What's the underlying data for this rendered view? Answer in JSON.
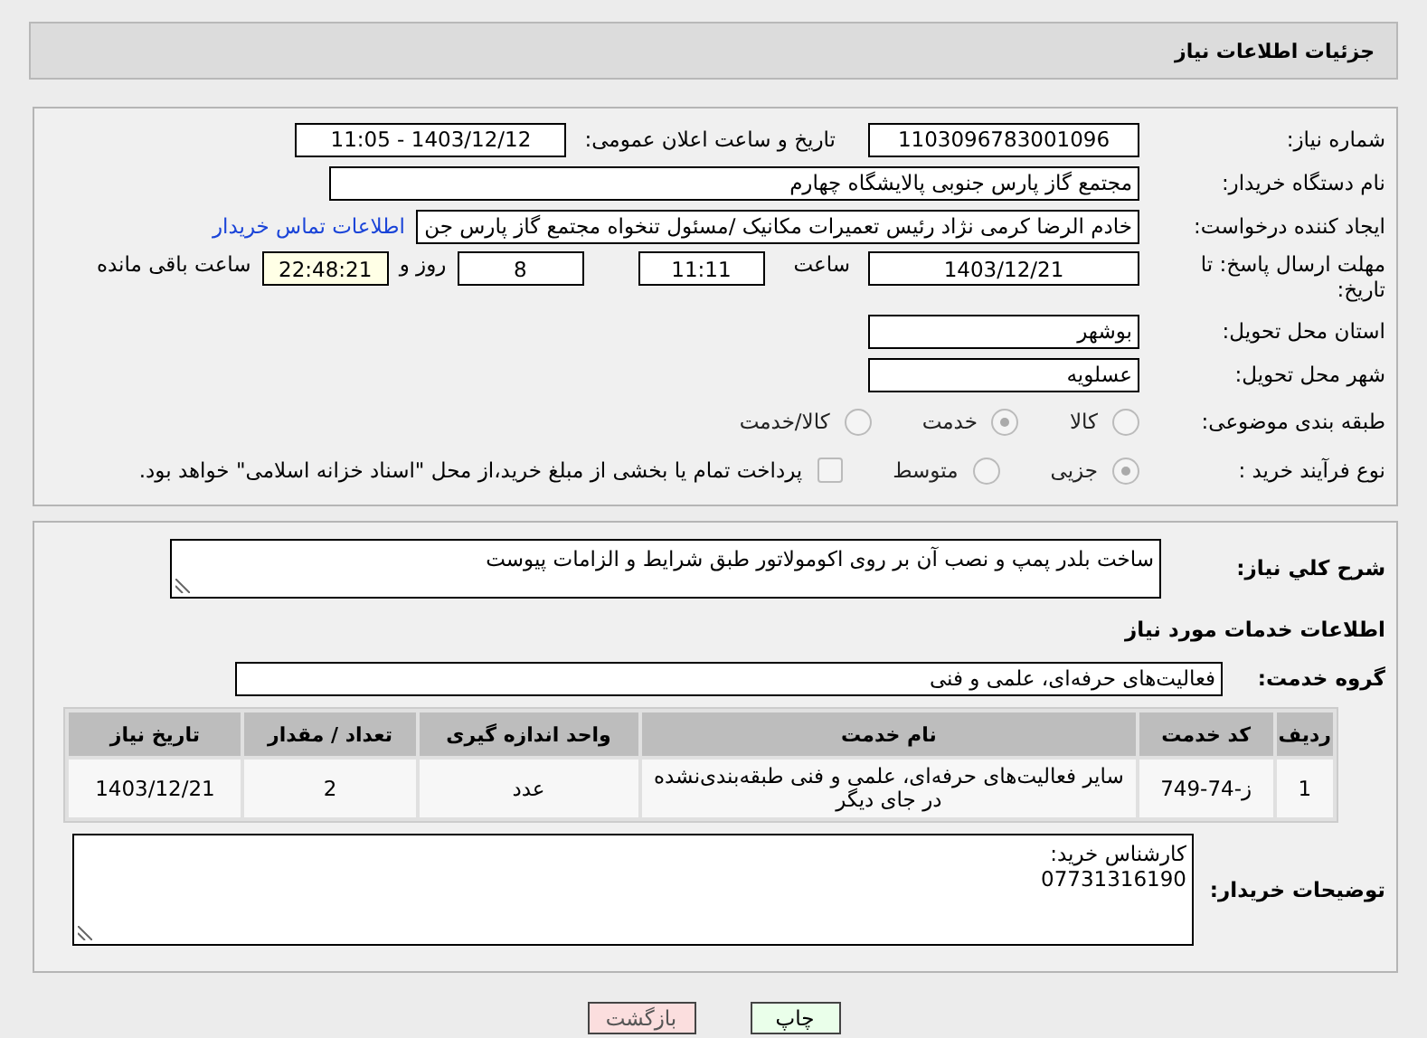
{
  "header": {
    "title": "جزئیات اطلاعات نیاز"
  },
  "details": {
    "need_number": {
      "label": "شماره نیاز:",
      "value": "1103096783001096"
    },
    "announce": {
      "label": "تاریخ و ساعت اعلان عمومی:",
      "value": "1403/12/12 - 11:05"
    },
    "buyer_org": {
      "label": "نام دستگاه خریدار:",
      "value": "مجتمع گاز پارس جنوبی  پالایشگاه چهارم"
    },
    "creator": {
      "label": "ایجاد کننده درخواست:",
      "value": "خادم الرضا کرمی نژاد رئیس تعمیرات مکانیک /مسئول تنخواه مجتمع گاز پارس جن",
      "link": "اطلاعات تماس خریدار"
    },
    "deadline": {
      "label": "مهلت ارسال پاسخ: تا تاریخ:",
      "date": "1403/12/21",
      "time_label": "ساعت",
      "time": "11:11",
      "days": "8",
      "days_label": "روز و",
      "remaining": "22:48:21",
      "remaining_label": "ساعت باقی مانده"
    },
    "province": {
      "label": "استان محل تحویل:",
      "value": "بوشهر"
    },
    "city": {
      "label": "شهر محل تحویل:",
      "value": "عسلویه"
    },
    "category": {
      "label": "طبقه بندی موضوعی:",
      "disabled": true,
      "options": [
        {
          "label": "کالا",
          "selected": false
        },
        {
          "label": "خدمت",
          "selected": true
        },
        {
          "label": "کالا/خدمت",
          "selected": false
        }
      ]
    },
    "process": {
      "label": "نوع فرآیند خرید :",
      "disabled": true,
      "options": [
        {
          "label": "جزیی",
          "selected": true
        },
        {
          "label": "متوسط",
          "selected": false
        }
      ],
      "treasury": {
        "label": "پرداخت تمام یا بخشی از مبلغ خرید،از محل \"اسناد خزانه اسلامی\" خواهد بود.",
        "checked": false
      }
    }
  },
  "needs": {
    "description": {
      "label": "شرح کلي نياز:",
      "value": "ساخت بلدر پمپ و نصب آن بر روی اکومولاتور طبق شرایط و الزامات پیوست"
    },
    "section_title": "اطلاعات خدمات مورد نیاز",
    "service_group": {
      "label": "گروه خدمت:",
      "value": "فعالیت‌های حرفه‌ای، علمی و فنی"
    },
    "table": {
      "columns": [
        "ردیف",
        "کد خدمت",
        "نام خدمت",
        "واحد اندازه گیری",
        "تعداد / مقدار",
        "تاریخ نیاز"
      ],
      "rows": [
        [
          "1",
          "ز-74-749",
          "سایر فعالیت‌های حرفه‌ای، علمی و فنی طبقه‌بندی‌نشده در جای دیگر",
          "عدد",
          "2",
          "1403/12/21"
        ]
      ]
    },
    "buyer_notes": {
      "label": "توضیحات خریدار:",
      "lines": [
        "کارشناس خرید:",
        "07731316190"
      ]
    }
  },
  "buttons": [
    {
      "label": "چاپ",
      "kind": "print"
    },
    {
      "label": "بازگشت",
      "kind": "back"
    }
  ]
}
